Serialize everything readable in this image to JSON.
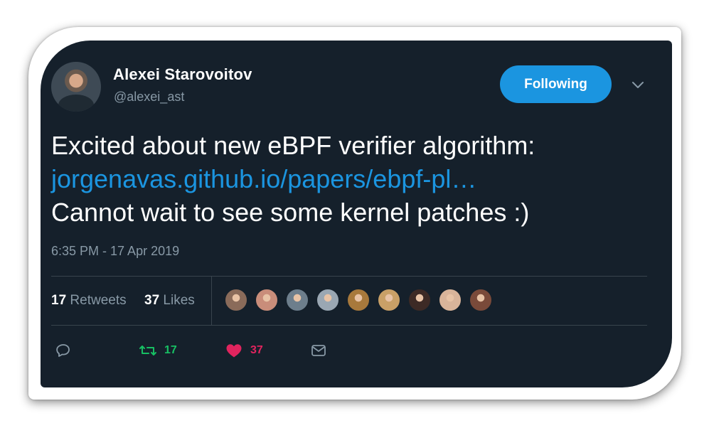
{
  "author": {
    "name": "Alexei Starovoitov",
    "handle": "@alexei_ast"
  },
  "follow_button": {
    "label": "Following"
  },
  "tweet": {
    "line1": "Excited about new eBPF verifier algorithm:",
    "link": "jorgenavas.github.io/papers/ebpf-pl…",
    "line3": "Cannot wait to see some kernel patches :)",
    "timestamp": "6:35 PM - 17 Apr 2019"
  },
  "stats": {
    "retweets_count": "17",
    "retweets_label": "Retweets",
    "likes_count": "37",
    "likes_label": "Likes"
  },
  "likers": [
    {
      "color": "#8a6b5a"
    },
    {
      "color": "#c98d7a"
    },
    {
      "color": "#6d7e8c"
    },
    {
      "color": "#9aa7b3"
    },
    {
      "color": "#a8793c"
    },
    {
      "color": "#c9a067"
    },
    {
      "color": "#3d2a25"
    },
    {
      "color": "#d9b49a"
    },
    {
      "color": "#7a4a3a"
    }
  ],
  "actions": {
    "reply_icon": "reply-icon",
    "retweet_count": "17",
    "like_count": "37",
    "dm_icon": "envelope-icon"
  },
  "colors": {
    "background": "#15202b",
    "accent": "#1b95e0",
    "muted": "#8899a6",
    "retweet": "#17bf63",
    "like": "#e0245e"
  }
}
